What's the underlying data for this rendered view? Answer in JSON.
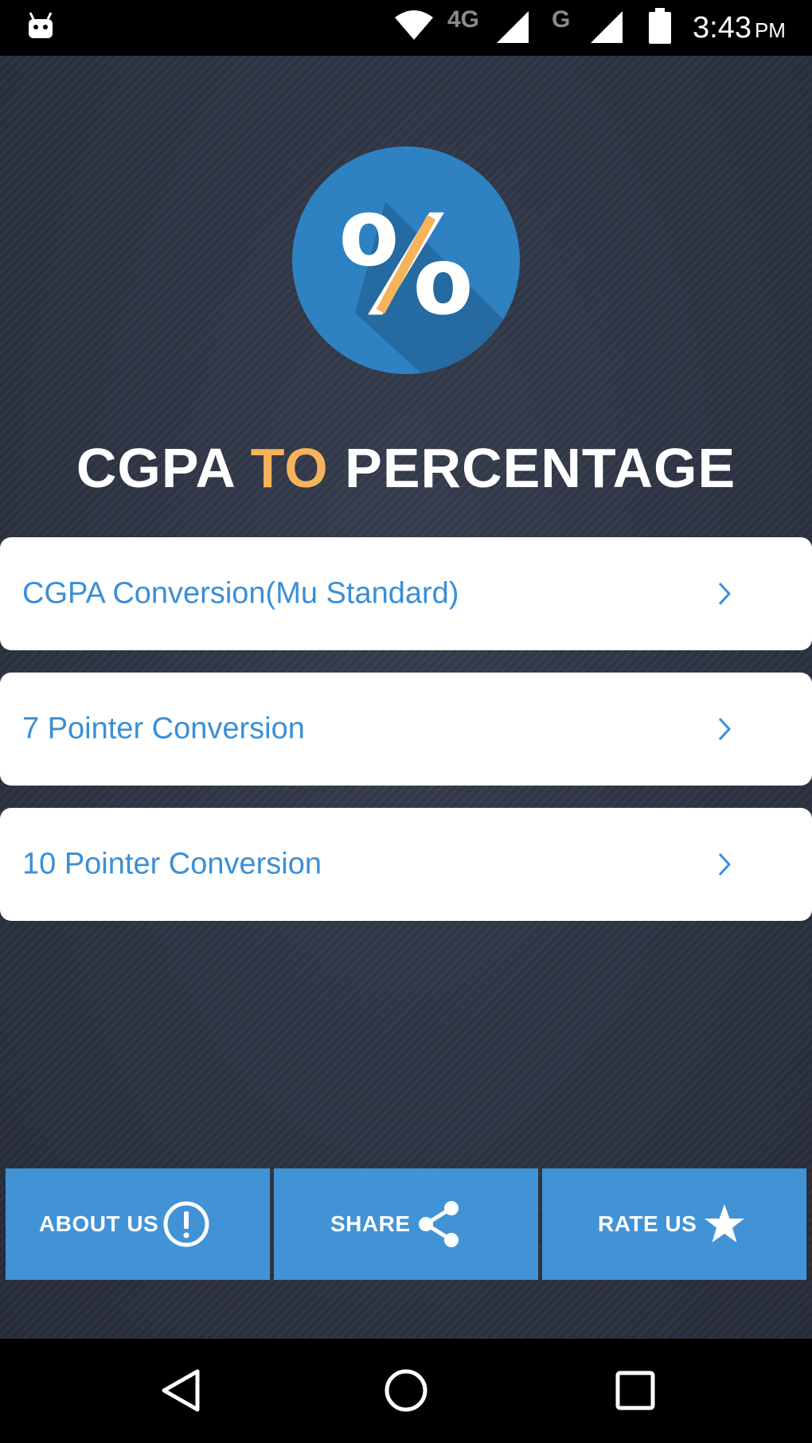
{
  "status_bar": {
    "network_label": "4G",
    "network2_label": "G",
    "time": "3:43",
    "ampm": "PM"
  },
  "app": {
    "title_part1": "CGPA",
    "title_part2": "TO",
    "title_part3": "PERCENTAGE",
    "logo_text": "%",
    "accent_color": "#f7b35b",
    "link_color": "#3a8fd6"
  },
  "menu": {
    "items": [
      {
        "label": "CGPA Conversion(Mu Standard)",
        "icon": "chevron-right-icon"
      },
      {
        "label": "7 Pointer Conversion",
        "icon": "chevron-right-icon"
      },
      {
        "label": "10 Pointer Conversion",
        "icon": "chevron-right-icon"
      }
    ]
  },
  "bottom_bar": {
    "about": {
      "label": "ABOUT US",
      "icon": "info-icon"
    },
    "share": {
      "label": "SHARE",
      "icon": "share-icon"
    },
    "rate": {
      "label": "RATE US",
      "icon": "star-icon"
    },
    "color": "#4293d6"
  },
  "nav_bar": {
    "back_icon": "back-triangle-icon",
    "home_icon": "home-circle-icon",
    "recents_icon": "recents-square-icon"
  }
}
